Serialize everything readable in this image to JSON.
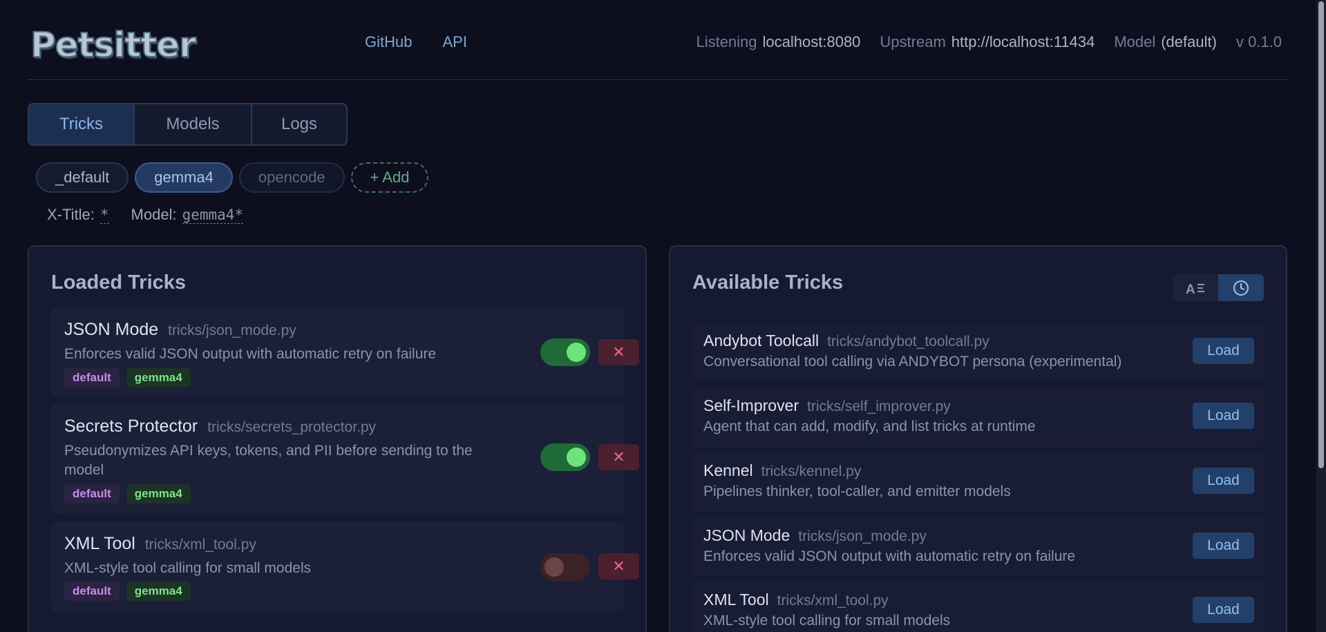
{
  "app": {
    "logo": "Petsitter"
  },
  "nav": {
    "links": [
      "GitHub",
      "API"
    ]
  },
  "status": {
    "listening_label": "Listening",
    "listening_value": "localhost:8080",
    "upstream_label": "Upstream",
    "upstream_value": "http://localhost:11434",
    "model_label": "Model",
    "model_value": "(default)",
    "version": "v 0.1.0"
  },
  "tabs": [
    "Tricks",
    "Models",
    "Logs"
  ],
  "profiles": {
    "items": [
      "_default",
      "gemma4",
      "opencode"
    ],
    "add_label": "+ Add"
  },
  "filters": {
    "xtitle_label": "X-Title:",
    "xtitle_value": "*",
    "model_label": "Model:",
    "model_value": "gemma4*"
  },
  "loaded": {
    "title": "Loaded Tricks",
    "items": [
      {
        "name": "JSON Mode",
        "path": "tricks/json_mode.py",
        "desc": "Enforces valid JSON output with automatic retry on failure",
        "tags": [
          "default",
          "gemma4"
        ],
        "enabled": true,
        "remove_label": "✕"
      },
      {
        "name": "Secrets Protector",
        "path": "tricks/secrets_protector.py",
        "desc": "Pseudonymizes API keys, tokens, and PII before sending to the model",
        "tags": [
          "default",
          "gemma4"
        ],
        "enabled": true,
        "remove_label": "✕"
      },
      {
        "name": "XML Tool",
        "path": "tricks/xml_tool.py",
        "desc": "XML-style tool calling for small models",
        "tags": [
          "default",
          "gemma4"
        ],
        "enabled": false,
        "remove_label": "✕"
      }
    ]
  },
  "available": {
    "title": "Available Tricks",
    "load_label": "Load",
    "sort_icons": [
      "sort-alpha-icon",
      "clock-icon"
    ],
    "items": [
      {
        "name": "Andybot Toolcall",
        "path": "tricks/andybot_toolcall.py",
        "desc": "Conversational tool calling via ANDYBOT persona (experimental)"
      },
      {
        "name": "Self-Improver",
        "path": "tricks/self_improver.py",
        "desc": "Agent that can add, modify, and list tricks at runtime"
      },
      {
        "name": "Kennel",
        "path": "tricks/kennel.py",
        "desc": "Pipelines thinker, tool-caller, and emitter models"
      },
      {
        "name": "JSON Mode",
        "path": "tricks/json_mode.py",
        "desc": "Enforces valid JSON output with automatic retry on failure"
      },
      {
        "name": "XML Tool",
        "path": "tricks/xml_tool.py",
        "desc": "XML-style tool calling for small models"
      }
    ]
  }
}
